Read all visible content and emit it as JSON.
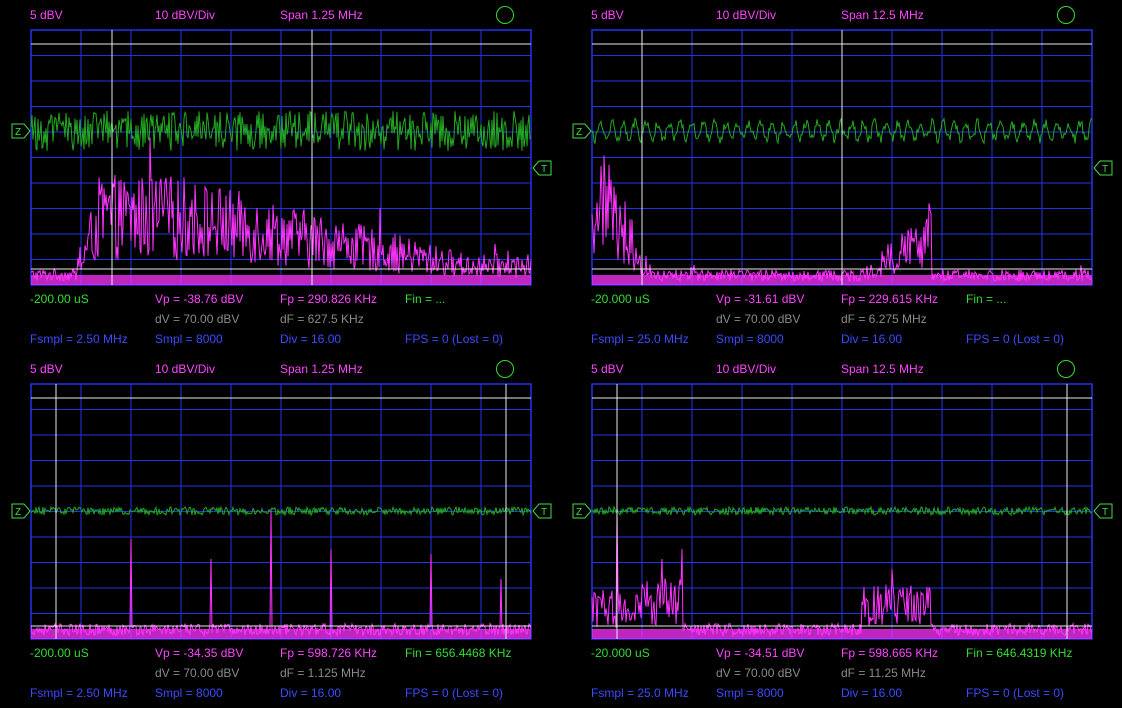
{
  "colors": {
    "background": "#000000",
    "grid": "#2233ee",
    "time_trace": "#22aa22",
    "spectrum": "#ff33ff",
    "cursor": "#e8e8e8",
    "marker": "#44dd44",
    "text_magenta": "#ff44ff",
    "text_green": "#33dd33",
    "text_gray": "#8a8a8a",
    "text_blue": "#3b4bff"
  },
  "icons": {
    "zero_marker": "Z",
    "trigger_marker": "T",
    "run_indicator": "circle-icon"
  },
  "panels": [
    {
      "volts_div": "5 dBV",
      "db_div": "10 dBV/Div",
      "span": "Span 1.25 MHz",
      "time": "-200.00 uS",
      "vp": "Vp = -38.76 dBV",
      "fp": "Fp = 290.826 KHz",
      "fin": "Fin = ...",
      "dv": "dV = 70.00 dBV",
      "df": "dF = 627.5 KHz",
      "fsmpl": "Fsmpl = 2.50 MHz",
      "smpl": "Smpl = 8000",
      "div": "Div = 16.00",
      "fps": "FPS = 0 (Lost = 0)"
    },
    {
      "volts_div": "5 dBV",
      "db_div": "10 dBV/Div",
      "span": "Span 12.5 MHz",
      "time": "-20.000 uS",
      "vp": "Vp = -31.61 dBV",
      "fp": "Fp = 229.615 KHz",
      "fin": "Fin = ...",
      "dv": "dV = 70.00 dBV",
      "df": "dF = 6.275 MHz",
      "fsmpl": "Fsmpl = 25.0 MHz",
      "smpl": "Smpl = 8000",
      "div": "Div = 16.00",
      "fps": "FPS = 0 (Lost = 0)"
    },
    {
      "volts_div": "5 dBV",
      "db_div": "10 dBV/Div",
      "span": "Span 1.25 MHz",
      "time": "-200.00 uS",
      "vp": "Vp = -34.35 dBV",
      "fp": "Fp = 598.726 KHz",
      "fin": "Fin = 656.4468 KHz",
      "dv": "dV = 70.00 dBV",
      "df": "dF = 1.125 MHz",
      "fsmpl": "Fsmpl = 2.50 MHz",
      "smpl": "Smpl = 8000",
      "div": "Div = 16.00",
      "fps": "FPS = 0 (Lost = 0)"
    },
    {
      "volts_div": "5 dBV",
      "db_div": "10 dBV/Div",
      "span": "Span 12.5 MHz",
      "time": "-20.000 uS",
      "vp": "Vp = -34.51 dBV",
      "fp": "Fp = 598.665 KHz",
      "fin": "Fin = 646.4319 KHz",
      "dv": "dV = 70.00 dBV",
      "df": "dF = 11.25 MHz",
      "fsmpl": "Fsmpl = 25.0 MHz",
      "smpl": "Smpl = 8000",
      "div": "Div = 16.00",
      "fps": "FPS = 0 (Lost = 0)"
    }
  ]
}
